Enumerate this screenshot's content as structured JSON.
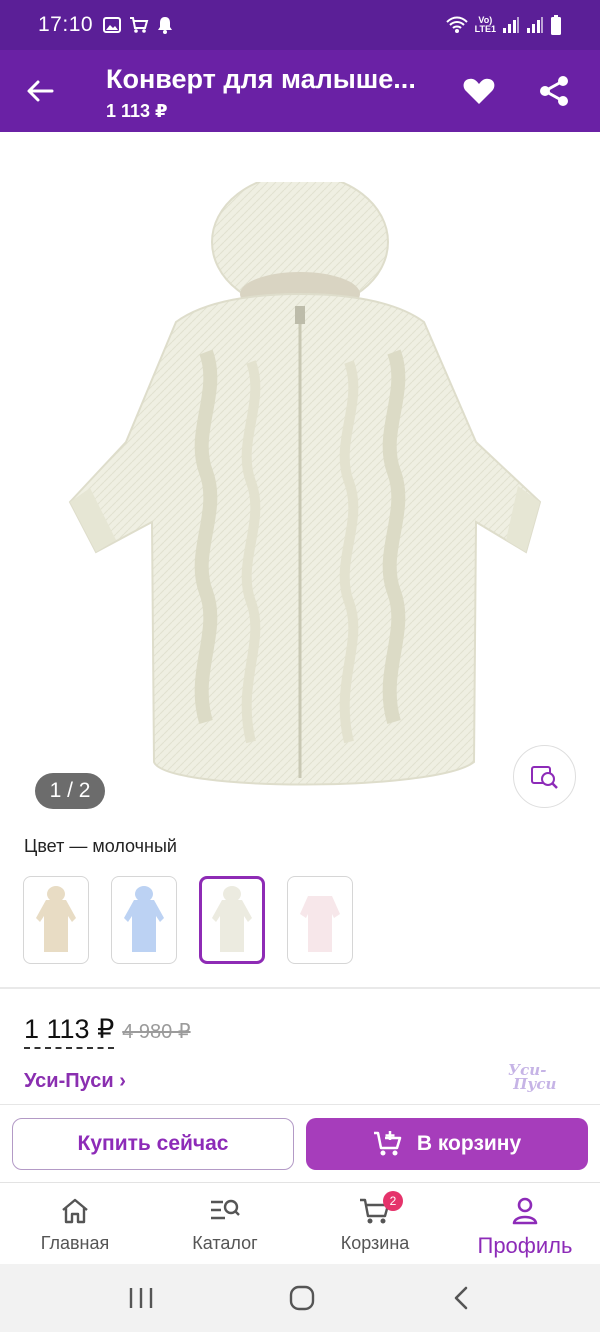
{
  "status_bar": {
    "time": "17:10",
    "network": "LTE1"
  },
  "header": {
    "title": "Конверт для малыше...",
    "price": "1 113 ₽"
  },
  "gallery": {
    "counter": "1 / 2"
  },
  "color": {
    "label": "Цвет — молочный",
    "swatch_colors": [
      "#e8dcc4",
      "#bcd2f3",
      "#efefe4",
      "#f7e7ea"
    ],
    "selected_index": 2
  },
  "price": {
    "current": "1 113 ₽",
    "old": "4 980 ₽"
  },
  "brand": {
    "name": "Уси-Пуси ›",
    "logo_text": "Уси-Пуси"
  },
  "actions": {
    "buy_now": "Купить сейчас",
    "add_to_cart": "В корзину"
  },
  "bottom_nav": {
    "items": [
      {
        "label": "Главная",
        "icon": "home-icon"
      },
      {
        "label": "Каталог",
        "icon": "catalog-search-icon"
      },
      {
        "label": "Корзина",
        "icon": "cart-icon",
        "badge": "2"
      },
      {
        "label": "Профиль",
        "icon": "profile-icon",
        "active": true
      }
    ]
  },
  "colors": {
    "status_bar": "#5b1f97",
    "app_bar": "#6a21a5",
    "accent": "#a63dbb",
    "badge": "#e5336b"
  }
}
